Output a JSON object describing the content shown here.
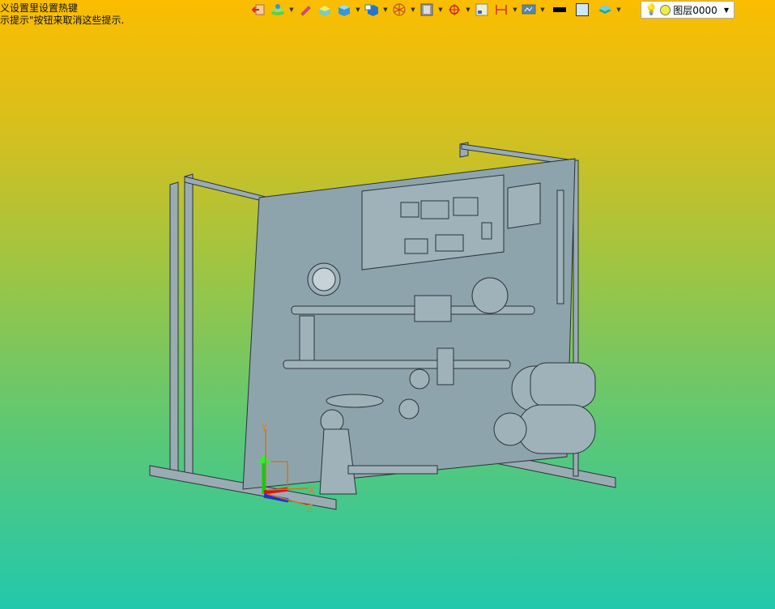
{
  "hints": [
    "义设置里设置热键",
    "示提示\"按钮来取消这些提示."
  ],
  "toolbar": {
    "icons": [
      "exit-icon",
      "layer-manager-icon",
      "pencil-icon",
      "box-icon",
      "solid-icon",
      "view-icon",
      "wireframe-icon",
      "section-icon",
      "target-icon",
      "frame-icon",
      "dimension-icon",
      "display-icon",
      "line-color-icon",
      "fill-color-icon",
      "layers-icon"
    ],
    "layer_select": {
      "value": "图层0000"
    }
  },
  "axes": {
    "x": "X",
    "y": "Y",
    "z": "Z"
  },
  "colors": {
    "bg_top": "#fbbd00",
    "bg_bottom": "#22c8ad",
    "model": "#8ea4ad"
  }
}
